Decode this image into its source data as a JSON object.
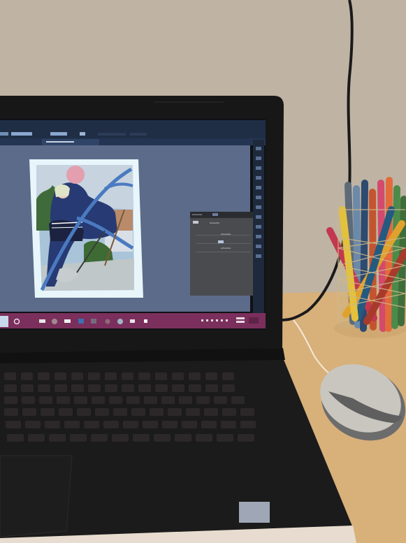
{
  "scene": {
    "description_tags": [
      "laptop",
      "photo-editing-app",
      "pencil-cup",
      "mouse",
      "desk"
    ],
    "colors": {
      "wall": "#bfb3a3",
      "desk": "#d8b07a",
      "laptop_body": "#1c1c1c",
      "screen_bezel": "#151617",
      "app_bg": "#5d6b8a",
      "app_header": "#1f2e45",
      "taskbar": "#7b2f5c",
      "panel": "#4a4b4e",
      "photo_frame": "#e8f6fb"
    }
  },
  "app": {
    "panel": {
      "title": "schaufen",
      "heading": "schaufen",
      "row_label_1": "schaufen",
      "row_label_2": "schaufen"
    }
  },
  "taskbar": {
    "icons": [
      "start-icon",
      "search-icon",
      "app-icon-1",
      "app-icon-2",
      "app-icon-3",
      "app-icon-4",
      "app-icon-5",
      "app-icon-6",
      "app-icon-7"
    ]
  }
}
